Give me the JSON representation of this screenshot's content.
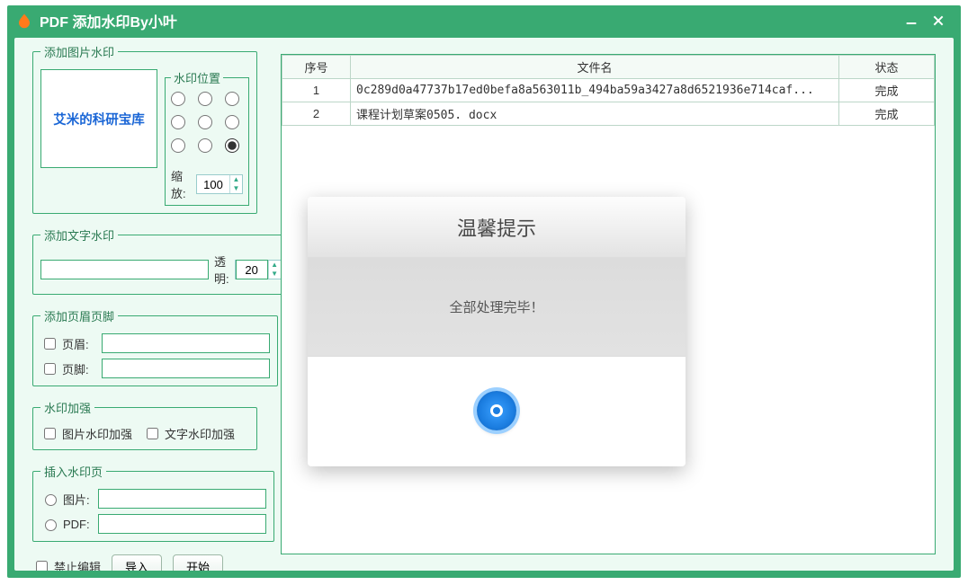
{
  "window": {
    "title": "PDF 添加水印By小叶"
  },
  "groups": {
    "image_wm": {
      "legend": "添加图片水印",
      "preview_text": "艾米的科研宝库",
      "pos_legend": "水印位置",
      "pos_selected_index": 8,
      "zoom_label": "缩放:",
      "zoom_value": "100"
    },
    "text_wm": {
      "legend": "添加文字水印",
      "text_value": "",
      "opacity_label": "透明:",
      "opacity_value": "20"
    },
    "header_footer": {
      "legend": "添加页眉页脚",
      "header_label": "页眉:",
      "footer_label": "页脚:",
      "header_value": "",
      "footer_value": ""
    },
    "enhance": {
      "legend": "水印加强",
      "img_enh_label": "图片水印加强",
      "text_enh_label": "文字水印加强"
    },
    "insert_page": {
      "legend": "插入水印页",
      "img_label": "图片:",
      "pdf_label": "PDF:",
      "img_value": "",
      "pdf_value": ""
    }
  },
  "bottom": {
    "lock_label": "禁止编辑",
    "import_label": "导入",
    "start_label": "开始"
  },
  "table": {
    "col_idx": "序号",
    "col_name": "文件名",
    "col_status": "状态",
    "rows": [
      {
        "idx": "1",
        "name": "0c289d0a47737b17ed0befa8a563011b_494ba59a3427a8d6521936e714caf...",
        "status": "完成"
      },
      {
        "idx": "2",
        "name": "课程计划草案0505. docx",
        "status": "完成"
      }
    ]
  },
  "dialog": {
    "title": "温馨提示",
    "message": "全部处理完毕！"
  }
}
